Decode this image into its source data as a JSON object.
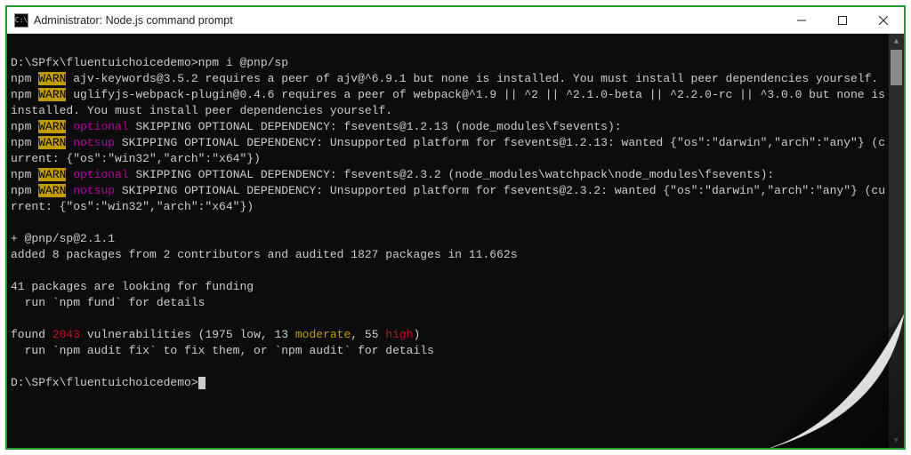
{
  "window": {
    "title": "Administrator: Node.js command prompt",
    "icon_text": "C:\\"
  },
  "prompt": {
    "path": "D:\\SPfx\\fluentuichoicedemo>",
    "command": "npm i @pnp/sp"
  },
  "tokens": {
    "npm": "npm",
    "warn": "WARN",
    "optional": "optional",
    "notsup": "notsup"
  },
  "lines": {
    "ajv": " ajv-keywords@3.5.2 requires a peer of ajv@^6.9.1 but none is installed. You must install peer dependencies yourself.",
    "uglify": " uglifyjs-webpack-plugin@0.4.6 requires a peer of webpack@^1.9 || ^2 || ^2.1.0-beta || ^2.2.0-rc || ^3.0.0 but none is installed. You must install peer dependencies yourself.",
    "opt1": " SKIPPING OPTIONAL DEPENDENCY: fsevents@1.2.13 (node_modules\\fsevents):",
    "notsup1": " SKIPPING OPTIONAL DEPENDENCY: Unsupported platform for fsevents@1.2.13: wanted {\"os\":\"darwin\",\"arch\":\"any\"} (current: {\"os\":\"win32\",\"arch\":\"x64\"})",
    "opt2": " SKIPPING OPTIONAL DEPENDENCY: fsevents@2.3.2 (node_modules\\watchpack\\node_modules\\fsevents):",
    "notsup2": " SKIPPING OPTIONAL DEPENDENCY: Unsupported platform for fsevents@2.3.2: wanted {\"os\":\"darwin\",\"arch\":\"any\"} (current: {\"os\":\"win32\",\"arch\":\"x64\"})",
    "installed": "+ @pnp/sp@2.1.1",
    "added": "added 8 packages from 2 contributors and audited 1827 packages in 11.662s",
    "funding1": "41 packages are looking for funding",
    "funding2": "  run `npm fund` for details",
    "vuln_pre": "found ",
    "vuln_count": "2043",
    "vuln_mid1": " vulnerabilities (1975 low, 13 ",
    "vuln_moderate": "moderate",
    "vuln_mid2": ", 55 ",
    "vuln_high": "high",
    "vuln_post": ")",
    "vuln2": "  run `npm audit fix` to fix them, or `npm audit` for details"
  }
}
